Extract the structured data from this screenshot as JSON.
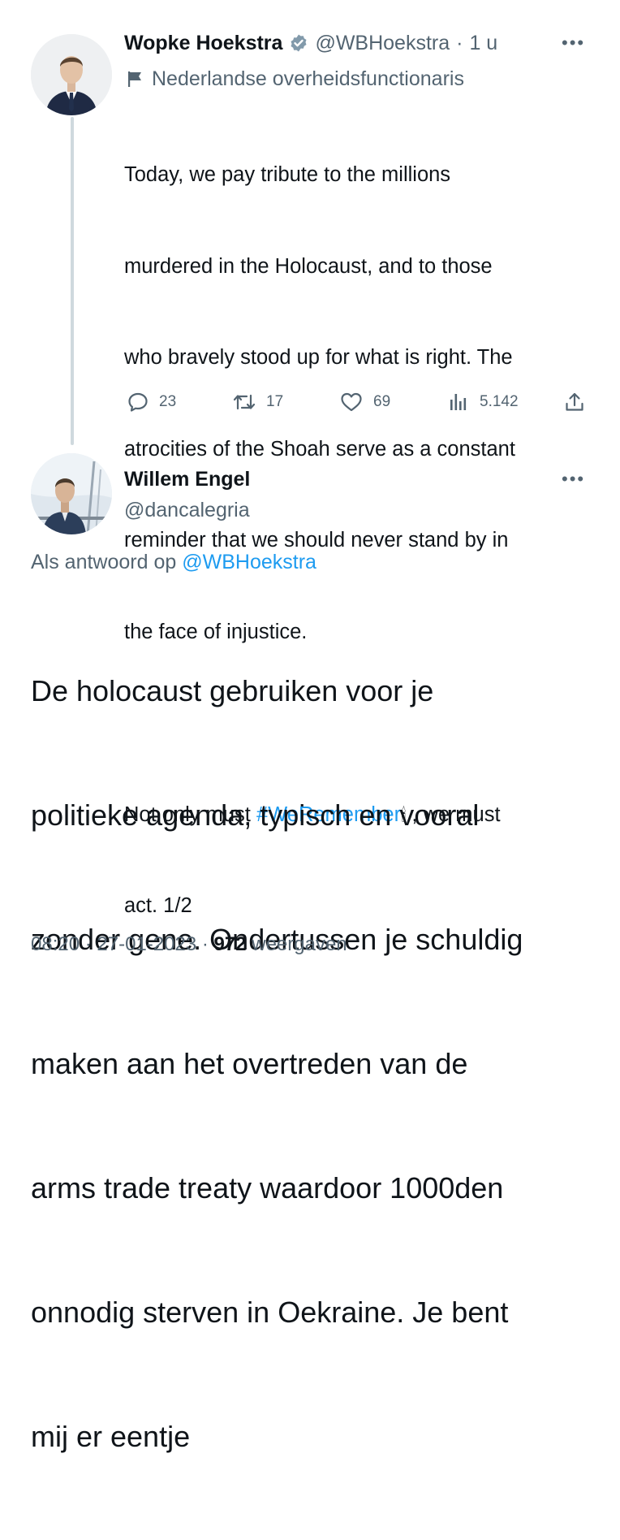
{
  "tweet1": {
    "name": "Wopke Hoekstra",
    "verified_color": "#829aab",
    "handle": "@WBHoekstra",
    "separator": "·",
    "time": "1 u",
    "label": "Nederlandse overheidsfunctionaris",
    "label_icon": "flag-icon",
    "text_lines": [
      "Today, we pay tribute to the millions",
      "murdered in the Holocaust, and to those",
      "who bravely stood up for what is right. The",
      "atrocities of the Shoah serve as a constant",
      "reminder that we should never stand by in",
      "the face of injustice."
    ],
    "text_after_prefix": "Not only must ",
    "hashtag": "#WeRemember",
    "emoji": "🕯",
    "text_after_suffix": " , we must",
    "text_last": "act. 1/2",
    "actions": {
      "replies": "23",
      "retweets": "17",
      "likes": "69",
      "views": "5.142"
    }
  },
  "tweet2": {
    "name": "Willem Engel",
    "handle": "@dancalegria",
    "reply_prefix": "Als antwoord op",
    "reply_handle": "@WBHoekstra",
    "text_lines": [
      "De holocaust gebruiken voor je",
      "politieke agenda, typisch en vooral",
      "zonder gene. Ondertussen je schuldig",
      "maken aan het overtreden van de",
      "arms trade treaty waardoor 1000den",
      "onnodig sterven in Oekraine. Je bent",
      "mij er eentje"
    ],
    "time": "08:20",
    "sep": "·",
    "date": "27-01-2023",
    "views_count": "972",
    "views_label": "weergaven"
  },
  "colors": {
    "link": "#1d9bf0",
    "muted": "#536471",
    "text": "#0f1419",
    "thread_line": "#cfd9de"
  }
}
